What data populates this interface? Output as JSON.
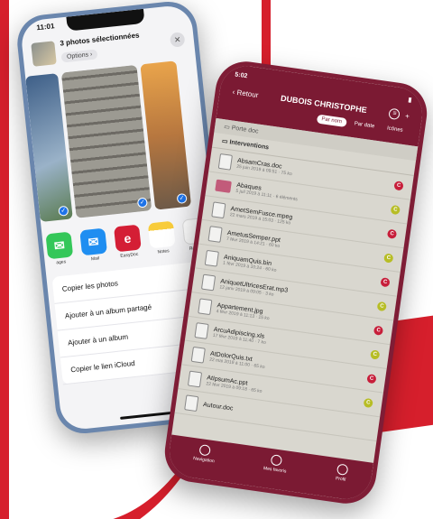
{
  "phone1": {
    "status_time": "11:01",
    "sheet_title": "3 photos sélectionnées",
    "options_label": "Options",
    "apps": [
      {
        "label": "ages",
        "icon": "messages-icon"
      },
      {
        "label": "Mail",
        "icon": "mail-icon"
      },
      {
        "label": "EasyDoc",
        "icon": "easydoc-icon"
      },
      {
        "label": "Notes",
        "icon": "notes-icon"
      },
      {
        "label": "Rappels",
        "icon": "reminders-icon"
      }
    ],
    "actions": [
      {
        "label": "Copier les photos",
        "icon": "copy-icon"
      },
      {
        "label": "Ajouter à un album partagé",
        "icon": "shared-album-icon"
      },
      {
        "label": "Ajouter à un album",
        "icon": "album-icon"
      },
      {
        "label": "Copier le lien iCloud",
        "icon": "cloud-link-icon"
      }
    ]
  },
  "phone2": {
    "status_time": "5:02",
    "back_label": "Retour",
    "title": "DUBOIS CHRISTOPHE",
    "sort_options": [
      "Par nom",
      "Par date",
      "Icônes"
    ],
    "path": "Porte doc",
    "folder": "Interventions",
    "files": [
      {
        "name": "AbsamCras.doc",
        "meta": "25 juin 2019 à 09:51 · 75 ko",
        "badge": "C",
        "color": "red"
      },
      {
        "name": "Abaques",
        "meta": "5 juil 2019 à 11:11 · 6 éléments",
        "badge": "C",
        "color": "yellow"
      },
      {
        "name": "AmetSemFusce.mpeg",
        "meta": "22 mars 2019 à 15:03 · 125 ko",
        "badge": "C",
        "color": "red"
      },
      {
        "name": "AmetusSemper.ppt",
        "meta": "7 févr 2019 à 14:21 · 60 ko",
        "badge": "C",
        "color": "yellow"
      },
      {
        "name": "AniquamQuis.bin",
        "meta": "1 févr 2019 à 10:24 · 60 ko",
        "badge": "C",
        "color": "red"
      },
      {
        "name": "AniquetUltricesErat.mp3",
        "meta": "12 janv 2019 à 09:05 · 3 ko",
        "badge": "C",
        "color": "yellow"
      },
      {
        "name": "Appartement.jpg",
        "meta": "4 févr 2019 à 11:13 · 15 ko",
        "badge": "C",
        "color": "red"
      },
      {
        "name": "ArcuAdipiscing.xls",
        "meta": "17 févr 2019 à 11:40 · 7 ko",
        "badge": "C",
        "color": "yellow"
      },
      {
        "name": "AtDolorQuis.txt",
        "meta": "22 mai 2019 à 11:00 · 65 ko",
        "badge": "C",
        "color": "red"
      },
      {
        "name": "AtIpsumAc.ppt",
        "meta": "22 févr 2019 à 09:18 · 65 ko",
        "badge": "C",
        "color": "yellow"
      },
      {
        "name": "Autour.doc",
        "meta": "",
        "badge": "",
        "color": "red"
      }
    ],
    "tabs": [
      {
        "label": "Navigation",
        "icon": "navigation-icon"
      },
      {
        "label": "Mes favoris",
        "icon": "favorites-icon"
      },
      {
        "label": "Profil",
        "icon": "profile-icon"
      }
    ]
  }
}
